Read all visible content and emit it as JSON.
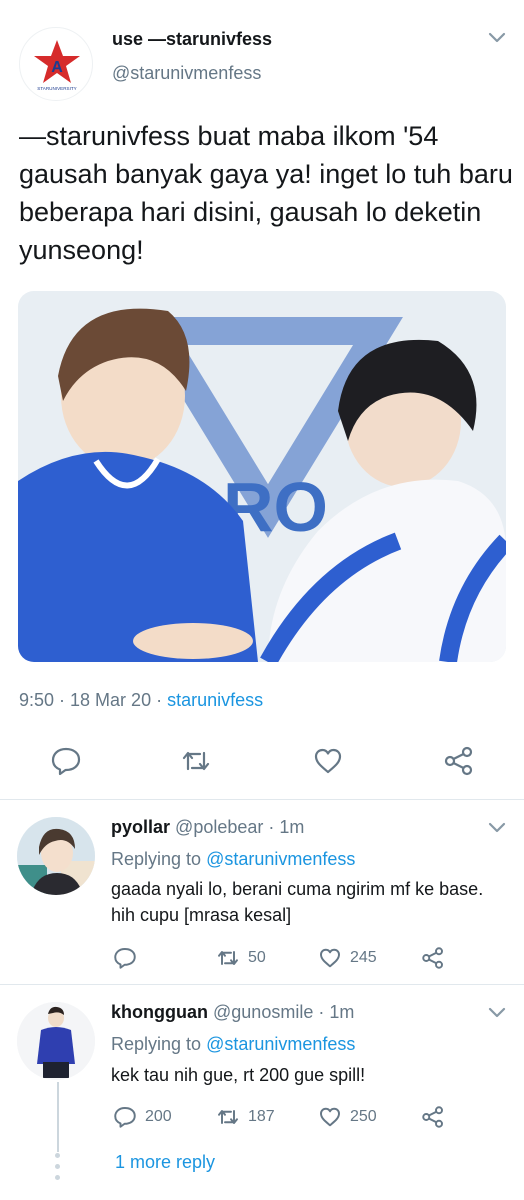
{
  "main_tweet": {
    "display_name": "use —starunivfess",
    "handle": "@starunivmenfess",
    "text": "—starunivfess buat maba ilkom '54 gausah banyak gaya ya! inget lo tuh baru beberapa hari disini, gausah lo deketin yunseong!",
    "time": "9:50 · 18 Mar 20 · ",
    "source": "starunivfess",
    "avatar_icon": "star-logo-icon",
    "avatar_caption": "STARUNIVERSITY",
    "actions": [
      "reply-icon",
      "retweet-icon",
      "like-icon",
      "share-icon"
    ]
  },
  "replies": [
    {
      "display_name": "pyollar",
      "handle": "@polebear",
      "time": " · 1m",
      "replying_prefix": "Replying to ",
      "replying_to": "@starunivmenfess",
      "text": "gaada nyali lo, berani cuma ngirim mf ke base. hih cupu [mrasa kesal]",
      "reply_count": "",
      "retweet_count": "50",
      "like_count": "245"
    },
    {
      "display_name": "khongguan",
      "handle": "@gunosmile",
      "time": " · 1m",
      "replying_prefix": "Replying to ",
      "replying_to": "@starunivmenfess",
      "text": "kek tau nih gue, rt 200 gue spill!",
      "reply_count": "200",
      "retweet_count": "187",
      "like_count": "250",
      "more_replies": "1 more reply"
    }
  ],
  "colors": {
    "link": "#1b95e0",
    "secondary_text": "#657786",
    "icon": "#657786",
    "divider": "#e1e8ed"
  }
}
